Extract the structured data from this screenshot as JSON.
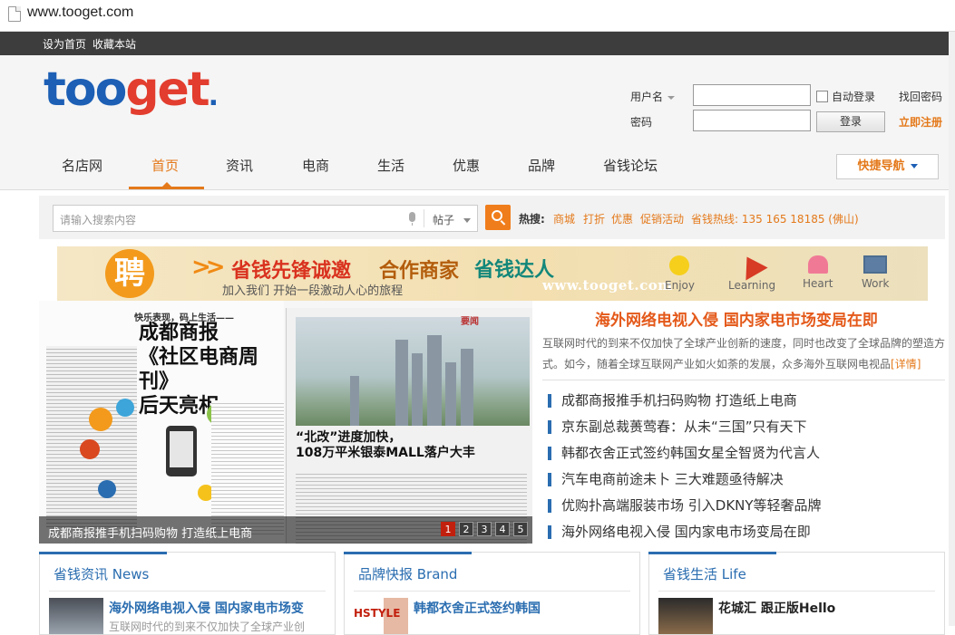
{
  "browser": {
    "url": "www.tooget.com"
  },
  "topbar": {
    "links": [
      "设为首页",
      "收藏本站"
    ]
  },
  "logo": {
    "part1": "too",
    "part2": "get",
    "dot": "."
  },
  "login": {
    "username_label": "用户名",
    "password_label": "密码",
    "username_value": "",
    "password_value": "",
    "auto_login": "自动登录",
    "forgot": "找回密码",
    "login_button": "登录",
    "register": "立即注册"
  },
  "nav": {
    "items": [
      "名店网",
      "首页",
      "资讯",
      "电商",
      "生活",
      "优惠",
      "品牌",
      "省钱论坛"
    ],
    "active": "首页",
    "quick_nav": "快捷导航"
  },
  "search": {
    "placeholder": "请输入搜索内容",
    "type_selected": "帖子",
    "hot_label": "热搜:",
    "hot_links": [
      "商城",
      "打折",
      "优惠",
      "促销活动",
      "省钱热线: 135 165 18185 (佛山)"
    ]
  },
  "banner": {
    "recruit_char": "聘",
    "title1": "省钱先锋诚邀",
    "title2": "合作商家",
    "title3": "省钱达人",
    "subtitle": "加入我们 开始一段激动人心的旅程",
    "url": "www.tooget.com",
    "icons": [
      {
        "icon": "sun-icon",
        "label": "Enjoy"
      },
      {
        "icon": "plane-icon",
        "label": "Learning"
      },
      {
        "icon": "heart-icon",
        "label": "Heart"
      },
      {
        "icon": "monitor-icon",
        "label": "Work"
      }
    ]
  },
  "feature": {
    "paper_small": "快乐表现，码上生活——",
    "paper_title": [
      "成都商报",
      "《社区电商周刊》",
      "后天亮相"
    ],
    "paper_headline": [
      "“北改”进度加快，",
      "108万平米银泰MALL落户大丰"
    ],
    "paper_mark": "要闻",
    "caption": "成都商报推手机扫码购物 打造纸上电商",
    "pages": [
      "1",
      "2",
      "3",
      "4",
      "5"
    ],
    "active_page": "1"
  },
  "headline": {
    "title": "海外网络电视入侵 国内家电市场变局在即",
    "summary": "互联网时代的到来不仅加快了全球产业创新的速度，同时也改变了全球品牌的塑造方式。如今，随着全球互联网产业如火如荼的发展，众多海外互联网电视品",
    "more": "[详情]"
  },
  "news_list": [
    "成都商报推手机扫码购物 打造纸上电商",
    "京东副总裁蒉莺春：从未“三国”只有天下",
    "韩都衣舍正式签约韩国女星全智贤为代言人",
    "汽车电商前途未卜 三大难题亟待解决",
    "优购扑高端服装市场 引入DKNY等轻奢品牌",
    "海外网络电视入侵 国内家电市场变局在即"
  ],
  "cards": [
    {
      "title": "省钱资讯 News",
      "item": "海外网络电视入侵 国内家电市场变",
      "sub": "互联网时代的到来不仅加快了全球产业创"
    },
    {
      "title": "品牌快报 Brand",
      "item": "韩都衣舍正式签约韩国",
      "sub": "",
      "thumb_text": "HSTYLE"
    },
    {
      "title": "省钱生活 Life",
      "item": "花城汇 跟正版Hello",
      "sub": ""
    }
  ],
  "colors": {
    "accent": "#e4791a",
    "brand_blue": "#1c5fb5",
    "brand_red": "#e23d2e",
    "link_blue": "#2a6db0"
  }
}
